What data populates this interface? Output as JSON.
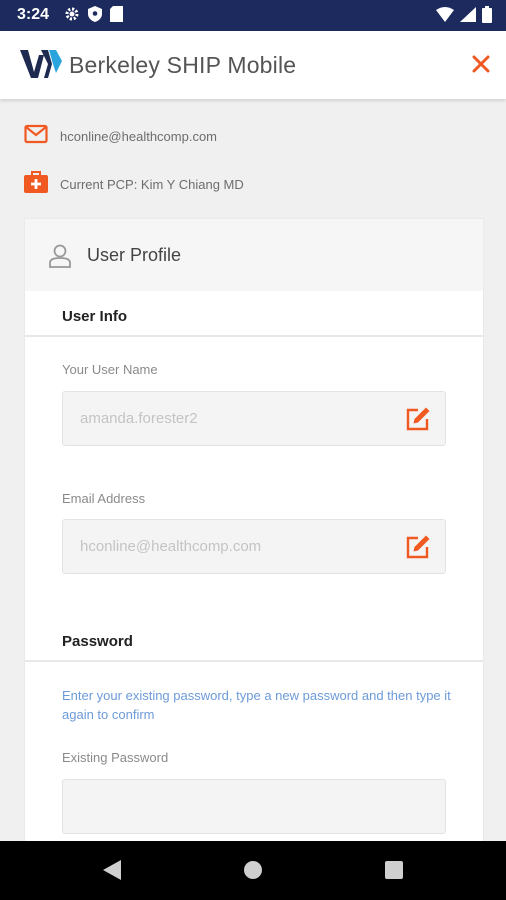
{
  "status_bar": {
    "time": "3:24"
  },
  "header": {
    "title": "Berkeley SHIP Mobile"
  },
  "contact": {
    "email": "hconline@healthcomp.com",
    "pcp": "Current PCP: Kim Y Chiang MD"
  },
  "profile": {
    "title": "User Profile",
    "user_info_title": "User Info",
    "username_label": "Your User Name",
    "username_value": "amanda.forester2",
    "email_label": "Email Address",
    "email_value": "hconline@healthcomp.com",
    "password_title": "Password",
    "password_hint": "Enter your existing password, type a new password and then type it again to confirm",
    "existing_password_label": "Existing Password"
  },
  "colors": {
    "accent": "#f05a22",
    "status_bar": "#1d2a5d",
    "hint": "#6d9bd8"
  }
}
